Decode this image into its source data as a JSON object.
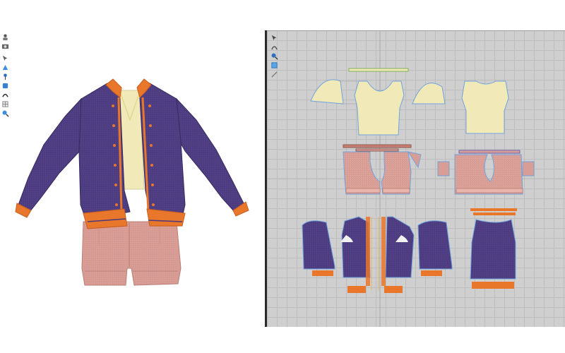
{
  "toolbar3d": {
    "tools": [
      {
        "icon": "avatar-icon"
      },
      {
        "icon": "camera-icon"
      },
      {
        "icon": "select-mesh-icon"
      },
      {
        "icon": "fold-icon"
      },
      {
        "icon": "pin-icon"
      },
      {
        "icon": "tack-icon"
      },
      {
        "icon": "sewing-icon"
      },
      {
        "icon": "texture-icon"
      },
      {
        "icon": "zoom-icon"
      }
    ]
  },
  "toolbar2d": {
    "tools": [
      {
        "icon": "transform-pattern-icon"
      },
      {
        "icon": "edit-curve-icon"
      },
      {
        "icon": "zoom-icon"
      },
      {
        "icon": "select-icon"
      },
      {
        "icon": "internal-line-icon"
      }
    ]
  },
  "colors": {
    "jacket": "#4c3a7d",
    "jacket_dark": "#3a2c63",
    "trim": "#e8762b",
    "top": "#f1eab8",
    "shorts": "#d89d94",
    "seam": "#6fa3df",
    "grid_bg": "#cfcfcf"
  }
}
